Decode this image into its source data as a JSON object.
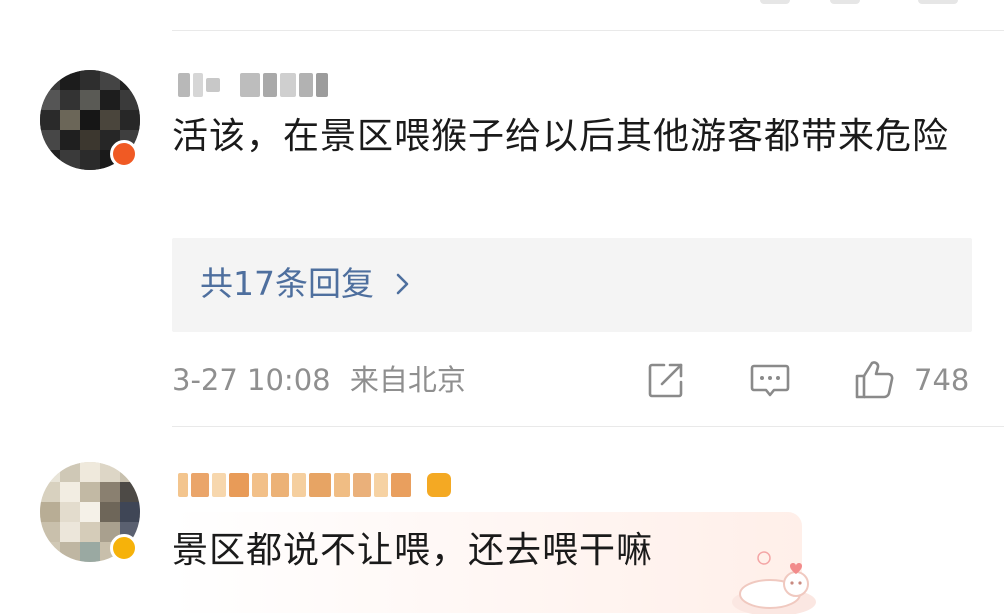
{
  "comments": [
    {
      "username": "",
      "text": "活该，在景区喂猴子给以后其他游客都带来危险",
      "replies_label": "共17条回复",
      "date": "3-27 10:08",
      "location": "来自北京",
      "like_count": "748",
      "icons": [
        "share-icon",
        "comment-icon",
        "thumbs-up-icon",
        "chevron-right-icon"
      ]
    },
    {
      "username": "",
      "text": "景区都说不让喂，还去喂干嘛"
    }
  ],
  "colors": {
    "link": "#4e6f9e",
    "meta": "#8f8f8f",
    "text": "#1a1a1a",
    "reply_bg": "#f4f4f4",
    "badge_orange": "#f05a24",
    "badge_gold": "#f6b20a"
  }
}
